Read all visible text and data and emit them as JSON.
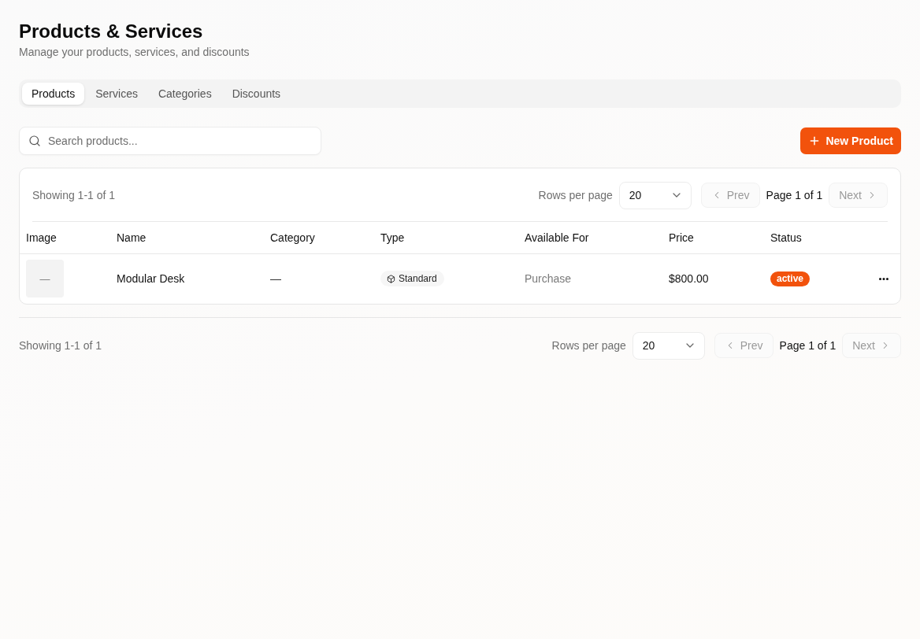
{
  "header": {
    "title": "Products & Services",
    "subtitle": "Manage your products, services, and discounts"
  },
  "tabs": [
    {
      "label": "Products",
      "selected": true
    },
    {
      "label": "Services",
      "selected": false
    },
    {
      "label": "Categories",
      "selected": false
    },
    {
      "label": "Discounts",
      "selected": false
    }
  ],
  "search": {
    "placeholder": "Search products..."
  },
  "new_button": {
    "label": "New Product"
  },
  "pagination_top": {
    "summary": "Showing 1-1 of 1",
    "rows_label": "Rows per page",
    "rows_value": "20",
    "prev": {
      "label": "Prev",
      "disabled": true
    },
    "page": "Page 1 of 1",
    "next": {
      "label": "Next",
      "disabled": true
    }
  },
  "table": {
    "columns": [
      "Image",
      "Name",
      "Category",
      "Type",
      "Available For",
      "Price",
      "Status"
    ],
    "rows": [
      {
        "image": "—",
        "name": "Modular Desk",
        "category": "—",
        "type": "Standard",
        "available_for": "Purchase",
        "price": "$800.00",
        "status": "active"
      }
    ]
  },
  "pagination_bottom": {
    "summary": "Showing 1-1 of 1",
    "rows_label": "Rows per page",
    "rows_value": "20",
    "prev": {
      "label": "Prev",
      "disabled": true
    },
    "page": "Page 1 of 1",
    "next": {
      "label": "Next",
      "disabled": true
    }
  }
}
